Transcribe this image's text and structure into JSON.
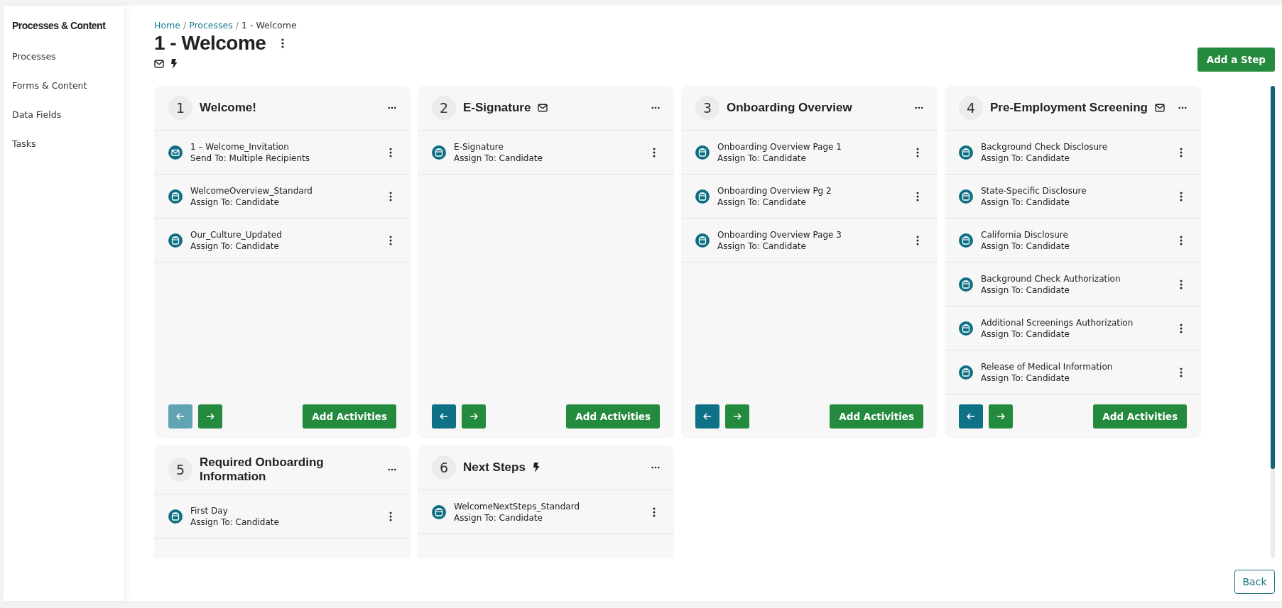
{
  "sidebar": {
    "title": "Processes & Content",
    "items": [
      {
        "label": "Processes"
      },
      {
        "label": "Forms & Content"
      },
      {
        "label": "Data Fields"
      },
      {
        "label": "Tasks"
      }
    ]
  },
  "breadcrumb": [
    {
      "label": "Home",
      "link": true
    },
    {
      "label": "Processes",
      "link": true
    },
    {
      "label": "1 - Welcome",
      "link": false
    }
  ],
  "separator": "/",
  "page_title": "1 - Welcome",
  "page_flags": {
    "email": true,
    "trigger": true
  },
  "add_step_button": "Add a Step",
  "steps": [
    {
      "number": "1",
      "title": "Welcome!",
      "email": false,
      "trigger": false,
      "activities": [
        {
          "kind": "email",
          "name": "1 – Welcome_Invitation",
          "assignee": "Send To: Multiple Recipients"
        },
        {
          "kind": "form",
          "name": "WelcomeOverview_Standard",
          "assignee": "Assign To: Candidate"
        },
        {
          "kind": "form",
          "name": "Our_Culture_Updated",
          "assignee": "Assign To: Candidate"
        }
      ],
      "footer": {
        "prev_disabled": true,
        "add_label": "Add Activities"
      }
    },
    {
      "number": "2",
      "title": "E-Signature",
      "email": true,
      "trigger": false,
      "activities": [
        {
          "kind": "form",
          "name": "E-Signature",
          "assignee": "Assign To: Candidate"
        }
      ],
      "footer": {
        "prev_disabled": false,
        "add_label": "Add Activities"
      }
    },
    {
      "number": "3",
      "title": "Onboarding Overview",
      "email": false,
      "trigger": false,
      "activities": [
        {
          "kind": "form",
          "name": "Onboarding Overview Page 1",
          "assignee": "Assign To: Candidate"
        },
        {
          "kind": "form",
          "name": "Onboarding Overview Pg 2",
          "assignee": "Assign To: Candidate"
        },
        {
          "kind": "form",
          "name": "Onboarding Overview Page 3",
          "assignee": "Assign To: Candidate"
        }
      ],
      "footer": {
        "prev_disabled": false,
        "add_label": "Add Activities"
      }
    },
    {
      "number": "4",
      "title": "Pre-Employment Screening",
      "email": true,
      "trigger": false,
      "activities": [
        {
          "kind": "form",
          "name": "Background Check Disclosure",
          "assignee": "Assign To: Candidate"
        },
        {
          "kind": "form",
          "name": "State-Specific Disclosure",
          "assignee": "Assign To: Candidate"
        },
        {
          "kind": "form",
          "name": "California Disclosure",
          "assignee": "Assign To: Candidate"
        },
        {
          "kind": "form",
          "name": "Background Check Authorization",
          "assignee": "Assign To: Candidate"
        },
        {
          "kind": "form",
          "name": "Additional Screenings Authorization",
          "assignee": "Assign To: Candidate"
        },
        {
          "kind": "form",
          "name": "Release of Medical Information",
          "assignee": "Assign To: Candidate"
        }
      ],
      "footer": {
        "prev_disabled": false,
        "add_label": "Add Activities"
      }
    },
    {
      "number": "5",
      "title": "Required Onboarding Information",
      "email": false,
      "trigger": false,
      "activities": [
        {
          "kind": "form",
          "name": "First Day",
          "assignee": "Assign To: Candidate"
        }
      ]
    },
    {
      "number": "6",
      "title": "Next Steps",
      "email": false,
      "trigger": true,
      "activities": [
        {
          "kind": "form",
          "name": "WelcomeNextSteps_Standard",
          "assignee": "Assign To: Candidate"
        }
      ]
    }
  ],
  "back_button": "Back"
}
